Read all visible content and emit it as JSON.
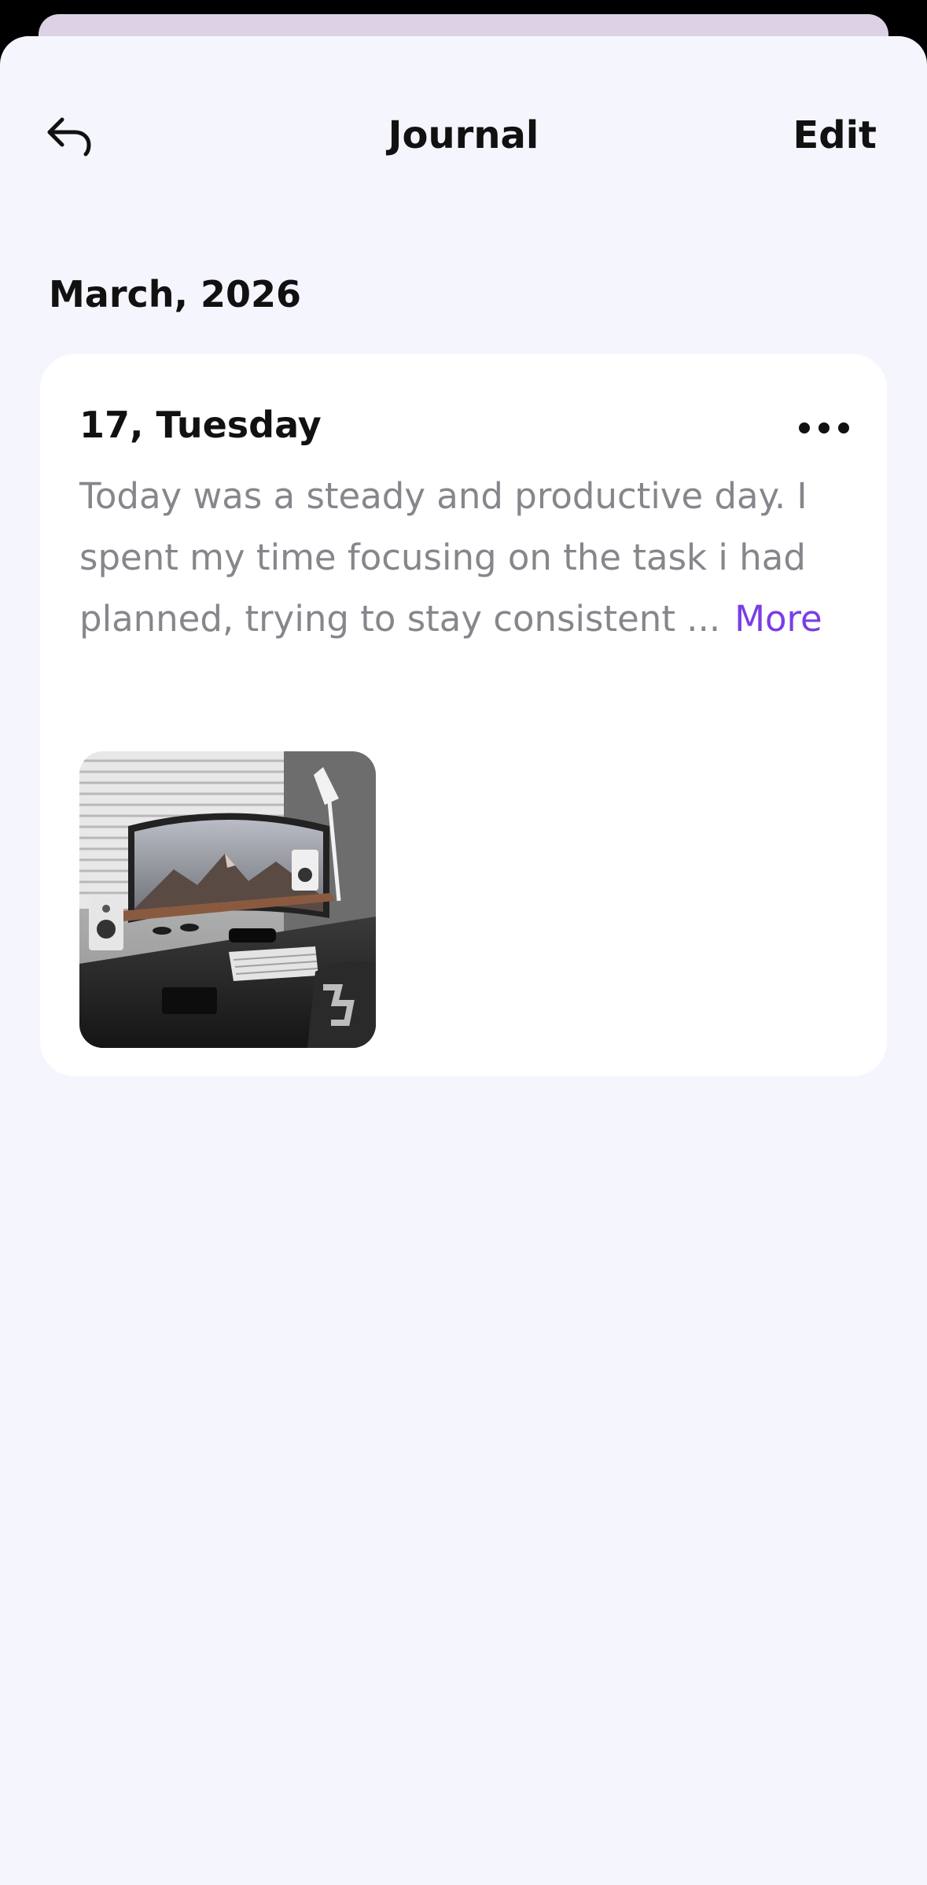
{
  "header": {
    "title": "Journal",
    "edit_label": "Edit",
    "back_icon": "back-arrow-icon"
  },
  "month": "March, 2026",
  "entry": {
    "date": "17, Tuesday",
    "text_lines": [
      "Today was a steady and productive day. I",
      "spent my time focusing on the task i had",
      "planned, trying to stay consistent ..."
    ],
    "more_label": "More",
    "menu_icon": "more-horizontal-icon",
    "photo_subject": "desk-setup-photo"
  },
  "colors": {
    "background": "#f5f5fe",
    "card": "#ffffff",
    "accent": "#7a3ee6",
    "body_text": "#86868c",
    "title_text": "#111111"
  }
}
